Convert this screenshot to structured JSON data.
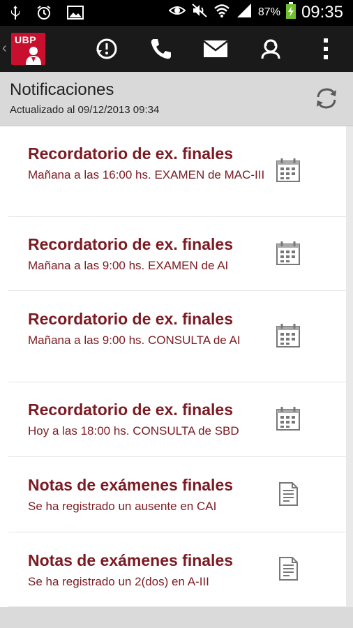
{
  "status_bar": {
    "battery_percent": "87%",
    "time": "09:35",
    "icons": [
      "usb-icon",
      "alarm-icon",
      "image-icon",
      "eye-icon",
      "mute-icon",
      "wifi-icon",
      "signal-icon",
      "battery-charging-icon"
    ]
  },
  "action_bar": {
    "logo_text": "UBP",
    "icons": [
      "notifications-history-icon",
      "phone-icon",
      "mail-icon",
      "contact-icon",
      "overflow-menu-icon"
    ],
    "accent": "#c8102e"
  },
  "header": {
    "title": "Notificaciones",
    "updated": "Actualizado al 09/12/2013 09:34",
    "refresh_icon": "refresh-icon"
  },
  "notifications": [
    {
      "title": "Recordatorio de ex. finales",
      "body": "Mañana a las 16:00 hs. EXAMEN de MAC-III",
      "icon": "calendar-icon"
    },
    {
      "title": "Recordatorio de ex. finales",
      "body": "Mañana a las 9:00 hs. EXAMEN de AI",
      "icon": "calendar-icon"
    },
    {
      "title": "Recordatorio de ex. finales",
      "body": "Mañana a las 9:00 hs. CONSULTA de AI",
      "icon": "calendar-icon"
    },
    {
      "title": "Recordatorio de ex. finales",
      "body": "Hoy a las 18:00 hs. CONSULTA de SBD",
      "icon": "calendar-icon"
    },
    {
      "title": "Notas de exámenes finales",
      "body": "Se ha registrado un ausente en CAI",
      "icon": "document-icon"
    },
    {
      "title": "Notas de exámenes finales",
      "body": "Se ha registrado un 2(dos) en A-III",
      "icon": "document-icon"
    }
  ],
  "colors": {
    "title_text": "#7b1a22",
    "status_bar_bg": "#000000",
    "action_bar_bg": "#1a1a1a",
    "subheader_bg": "#d9d9d9"
  }
}
